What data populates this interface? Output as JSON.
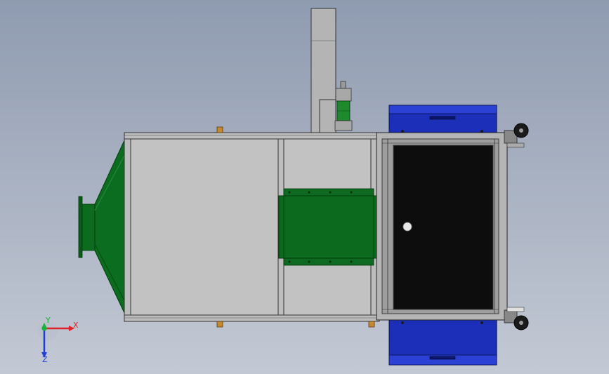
{
  "viewport": {
    "background_top": "#8f9bb0",
    "background_bottom": "#c3c9d4"
  },
  "model": {
    "colors": {
      "frame_gray": "#b7b7b7",
      "panel_gray": "#c0c0c0",
      "edge": "#2b2b2b",
      "green": "#0a6a1c",
      "green_dark": "#064a12",
      "blue": "#1c2fb8",
      "blue_dark": "#0a1670",
      "black_panel": "#0d0d0d",
      "brass": "#c58a2e"
    },
    "parts": [
      "inlet-flange",
      "inlet-hood",
      "main-housing",
      "chimney-duct",
      "pressure-gauge",
      "internal-filter",
      "end-frame",
      "blue-base",
      "caster-wheels"
    ]
  },
  "triad": {
    "x_label": "X",
    "y_label": "Y",
    "z_label": "Z",
    "x_color": "#e0202a",
    "y_color": "#19b33a",
    "z_color": "#1f3ed6"
  }
}
